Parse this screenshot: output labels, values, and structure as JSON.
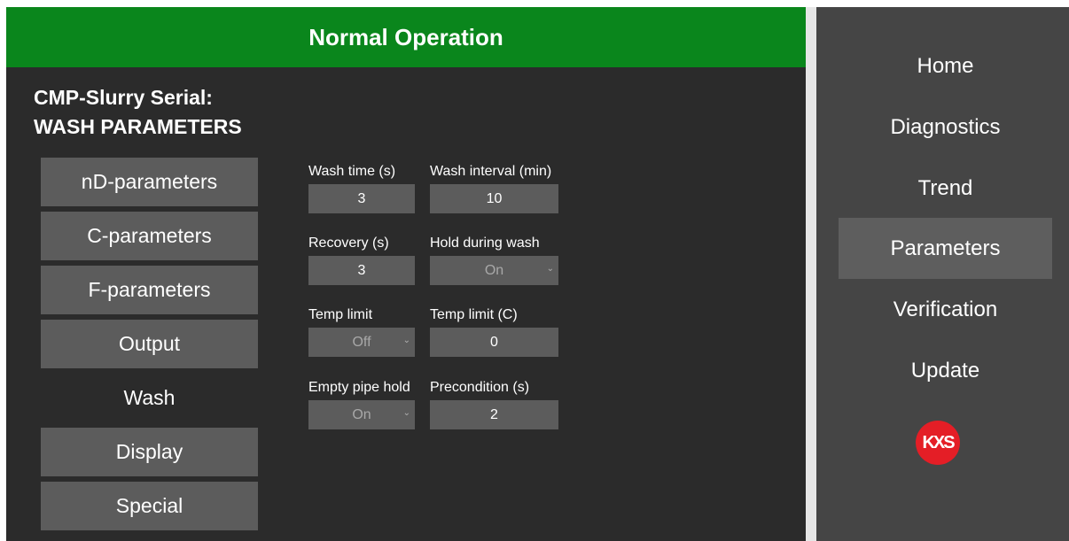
{
  "status": {
    "text": "Normal Operation",
    "color": "#0a861c"
  },
  "page": {
    "device_title": "CMP-Slurry Serial:",
    "section_title": "WASH PARAMETERS"
  },
  "subnav": {
    "items": [
      {
        "label": "nD-parameters",
        "active": false
      },
      {
        "label": "C-parameters",
        "active": false
      },
      {
        "label": "F-parameters",
        "active": false
      },
      {
        "label": "Output",
        "active": false
      },
      {
        "label": "Wash",
        "active": true
      },
      {
        "label": "Display",
        "active": false
      },
      {
        "label": "Special",
        "active": false
      }
    ]
  },
  "fields": {
    "wash_time": {
      "label": "Wash time (s)",
      "value": "3"
    },
    "wash_interval": {
      "label": "Wash interval (min)",
      "value": "10"
    },
    "recovery": {
      "label": "Recovery (s)",
      "value": "3"
    },
    "hold_during_wash": {
      "label": "Hold during wash",
      "value": "On",
      "icon": "chevron-down-icon"
    },
    "temp_limit_toggle": {
      "label": "Temp limit",
      "value": "Off",
      "icon": "chevron-down-icon"
    },
    "temp_limit_c": {
      "label": "Temp limit (C)",
      "value": "0"
    },
    "empty_pipe_hold": {
      "label": "Empty pipe hold",
      "value": "On",
      "icon": "chevron-down-icon"
    },
    "precondition": {
      "label": "Precondition (s)",
      "value": "2"
    }
  },
  "sidebar": {
    "items": [
      {
        "label": "Home",
        "active": false
      },
      {
        "label": "Diagnostics",
        "active": false
      },
      {
        "label": "Trend",
        "active": false
      },
      {
        "label": "Parameters",
        "active": true
      },
      {
        "label": "Verification",
        "active": false
      },
      {
        "label": "Update",
        "active": false
      }
    ],
    "logo": {
      "text": "KXS",
      "color": "#e41e26",
      "icon": "kxs-logo-icon"
    }
  }
}
